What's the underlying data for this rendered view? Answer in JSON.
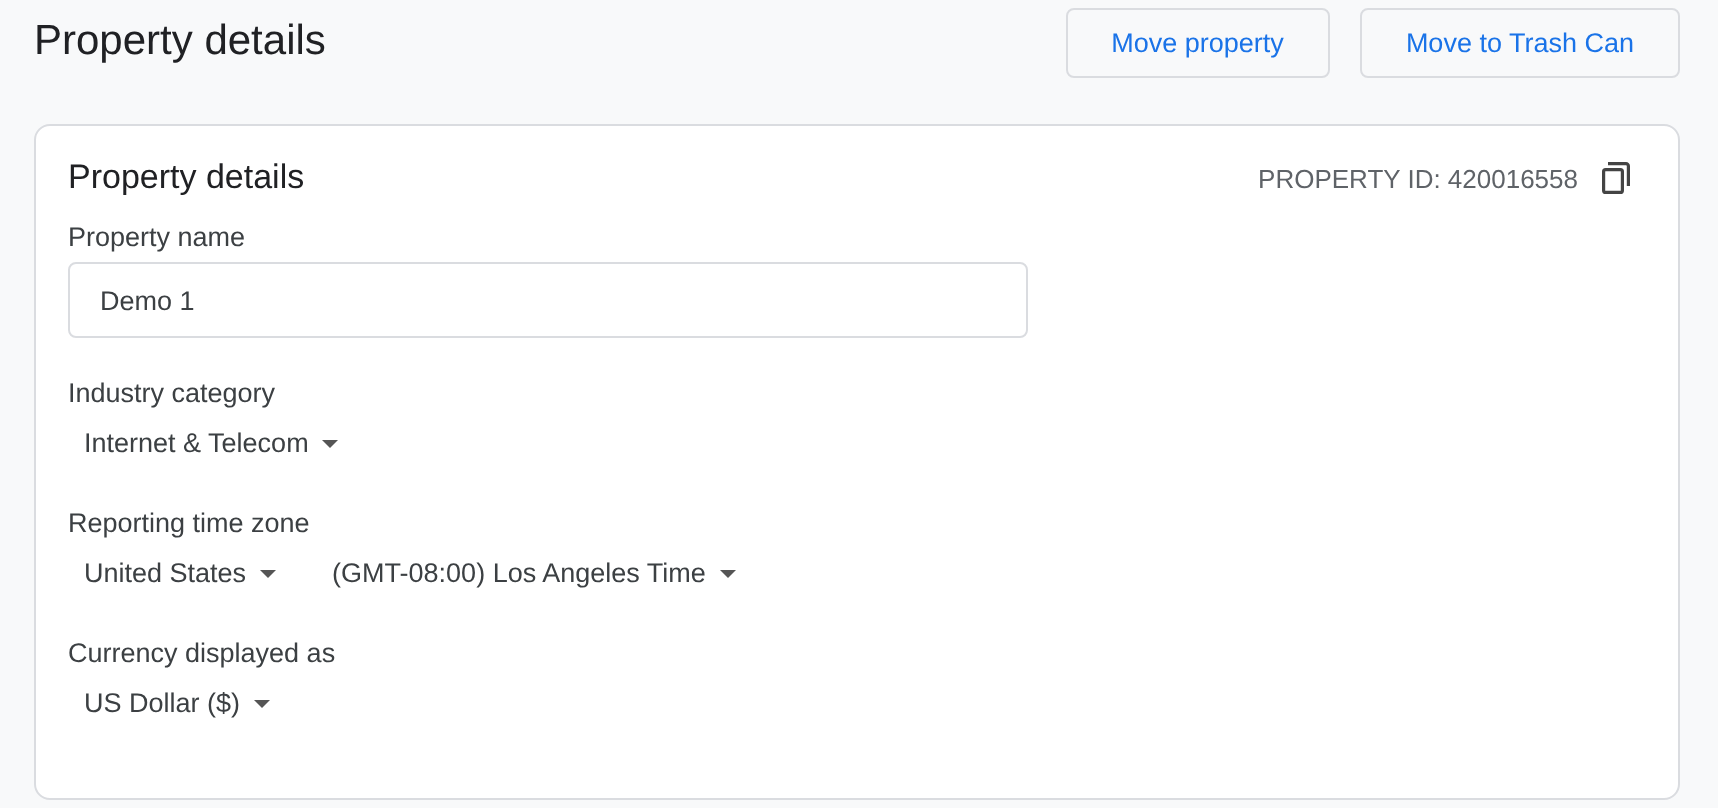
{
  "page_title": "Property details",
  "actions": [
    "Move property",
    "Move to Trash Can"
  ],
  "card": {
    "title": "Property details",
    "property_id": "PROPERTY ID: 420016558",
    "fields": [
      {
        "kind": "text",
        "label": "Property name",
        "value": "Demo 1"
      },
      {
        "kind": "dropdowns",
        "label": "Industry category",
        "values": [
          "Internet & Telecom"
        ]
      },
      {
        "kind": "dropdowns",
        "label": "Reporting time zone",
        "values": [
          "United States",
          "(GMT-08:00) Los Angeles Time"
        ]
      },
      {
        "kind": "dropdowns",
        "label": "Currency displayed as",
        "values": [
          "US Dollar ($)"
        ]
      }
    ]
  }
}
